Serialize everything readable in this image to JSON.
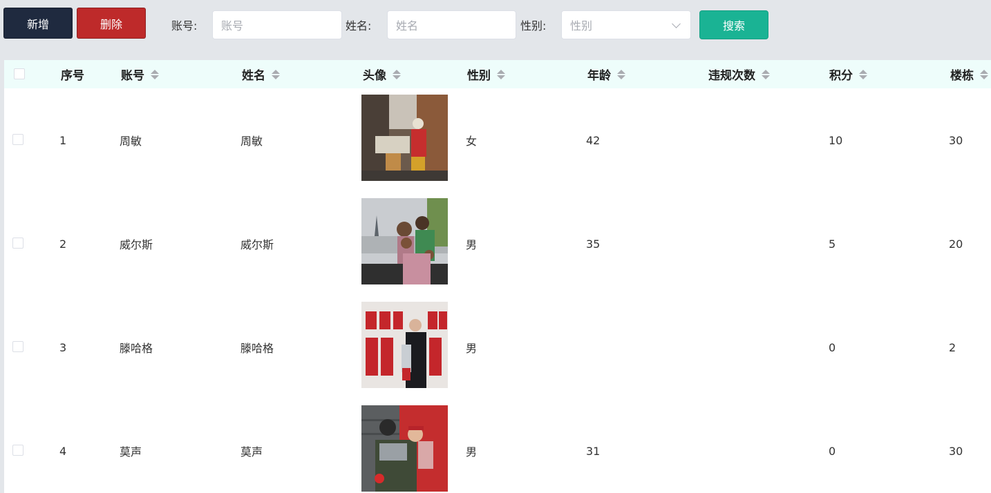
{
  "toolbar": {
    "add_label": "新增",
    "delete_label": "删除",
    "search_label": "搜索",
    "account_label": "账号:",
    "account_placeholder": "账号",
    "name_label": "姓名:",
    "name_placeholder": "姓名",
    "gender_label": "性别:",
    "gender_placeholder": "性别"
  },
  "table": {
    "headers": [
      "序号",
      "账号",
      "姓名",
      "头像",
      "性别",
      "年龄",
      "违规次数",
      "积分",
      "楼栋"
    ],
    "rows": [
      {
        "index": "1",
        "account": "周敏",
        "name": "周敏",
        "gender": "女",
        "age": "42",
        "violations": "",
        "points": "10",
        "building": "30",
        "avatar": "street-vendor-photo"
      },
      {
        "index": "2",
        "account": "威尔斯",
        "name": "威尔斯",
        "gender": "男",
        "age": "35",
        "violations": "",
        "points": "5",
        "building": "20",
        "avatar": "family-paris-photo"
      },
      {
        "index": "3",
        "account": "滕哈格",
        "name": "滕哈格",
        "gender": "男",
        "age": "",
        "violations": "",
        "points": "0",
        "building": "2",
        "avatar": "man-utd-trophy-photo"
      },
      {
        "index": "4",
        "account": "莫声",
        "name": "莫声",
        "gender": "男",
        "age": "31",
        "violations": "",
        "points": "0",
        "building": "30",
        "avatar": "hug-red-door-photo"
      }
    ]
  },
  "colors": {
    "add_button": "#1f2a3f",
    "delete_button": "#be2a2a",
    "search_button": "#1ab394",
    "header_bg": "#eefdfb"
  }
}
